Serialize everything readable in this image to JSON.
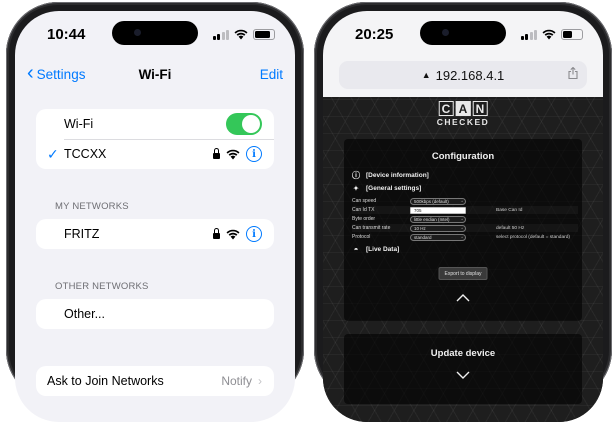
{
  "left_phone": {
    "status": {
      "time": "10:44"
    },
    "nav": {
      "back_label": "Settings",
      "title": "Wi-Fi",
      "edit_label": "Edit"
    },
    "wifi_group": {
      "wifi_label": "Wi-Fi",
      "wifi_on": true,
      "connected_network": "TCCXX"
    },
    "my_networks": {
      "header": "MY NETWORKS",
      "items": [
        "FRITZ"
      ]
    },
    "other_networks": {
      "header": "OTHER NETWORKS",
      "other_label": "Other..."
    },
    "ask_join": {
      "label": "Ask to Join Networks",
      "value": "Notify"
    },
    "icons": [
      "chevron-left-icon",
      "checkmark-icon",
      "lock-icon",
      "wifi-icon",
      "info-icon"
    ]
  },
  "right_phone": {
    "status": {
      "time": "20:25"
    },
    "url": "192.168.4.1",
    "logo": {
      "letters": [
        "C",
        "A",
        "N"
      ],
      "subtitle": "CHECKED"
    },
    "config": {
      "title": "Configuration",
      "device_info": "[Device information]",
      "general_settings": "[General settings]",
      "rows": [
        {
          "label": "Can speed",
          "control": "500kbps (default)",
          "type": "select",
          "hint": ""
        },
        {
          "label": "Can Id TX",
          "control": "705",
          "type": "input",
          "hint": "Base Can Id"
        },
        {
          "label": "Byte order",
          "control": "little endian (Intel)",
          "type": "select",
          "hint": ""
        },
        {
          "label": "Can transmit rate",
          "control": "10 Hz",
          "type": "select",
          "hint": "default 50 Hz"
        },
        {
          "label": "Protocol",
          "control": "standard",
          "type": "select",
          "hint": "select protocol (default = standard)"
        }
      ],
      "live_data": "[Live Data]",
      "export_button": "Export to display"
    },
    "update": {
      "title": "Update device"
    },
    "icons": [
      "lock-icon",
      "share-icon",
      "info-icon",
      "settings-icon",
      "gauge-icon",
      "chevron-up-icon",
      "chevron-down-icon"
    ]
  },
  "colors": {
    "ios_blue": "#007aff",
    "toggle_green": "#34c759",
    "web_bg": "#1e1e1e"
  }
}
